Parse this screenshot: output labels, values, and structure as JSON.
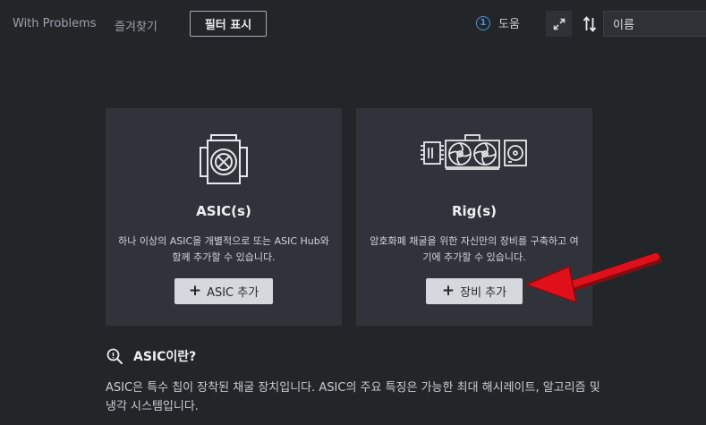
{
  "topbar": {
    "with_problems": "With Problems",
    "favorites": "즐겨찾기",
    "filter_label": "필터 표시",
    "help_icon_glyph": "1",
    "help_label": "도움",
    "sort_value": "이름"
  },
  "cards": {
    "asic": {
      "title": "ASIC(s)",
      "description": "하나 이상의 ASIC을 개별적으로 또는 ASIC Hub와 함께 추가할 수 있습니다.",
      "button_label": "ASIC 추가"
    },
    "rig": {
      "title": "Rig(s)",
      "description": "암호화폐 채굴을 위한 자신만의 장비를 구축하고 여기에 추가할 수 있습니다.",
      "button_label": "장비 추가"
    }
  },
  "info": {
    "title": "ASIC이란?",
    "text": "ASIC은 특수 칩이 장착된 채굴 장치입니다. ASIC의 주요 특징은 가능한 최대 해시레이트, 알고리즘 및 냉각 시스템입니다."
  },
  "colors": {
    "background": "#232629",
    "card": "#30343a",
    "accent_blue": "#4a90d9",
    "arrow_red": "#e0101a"
  }
}
